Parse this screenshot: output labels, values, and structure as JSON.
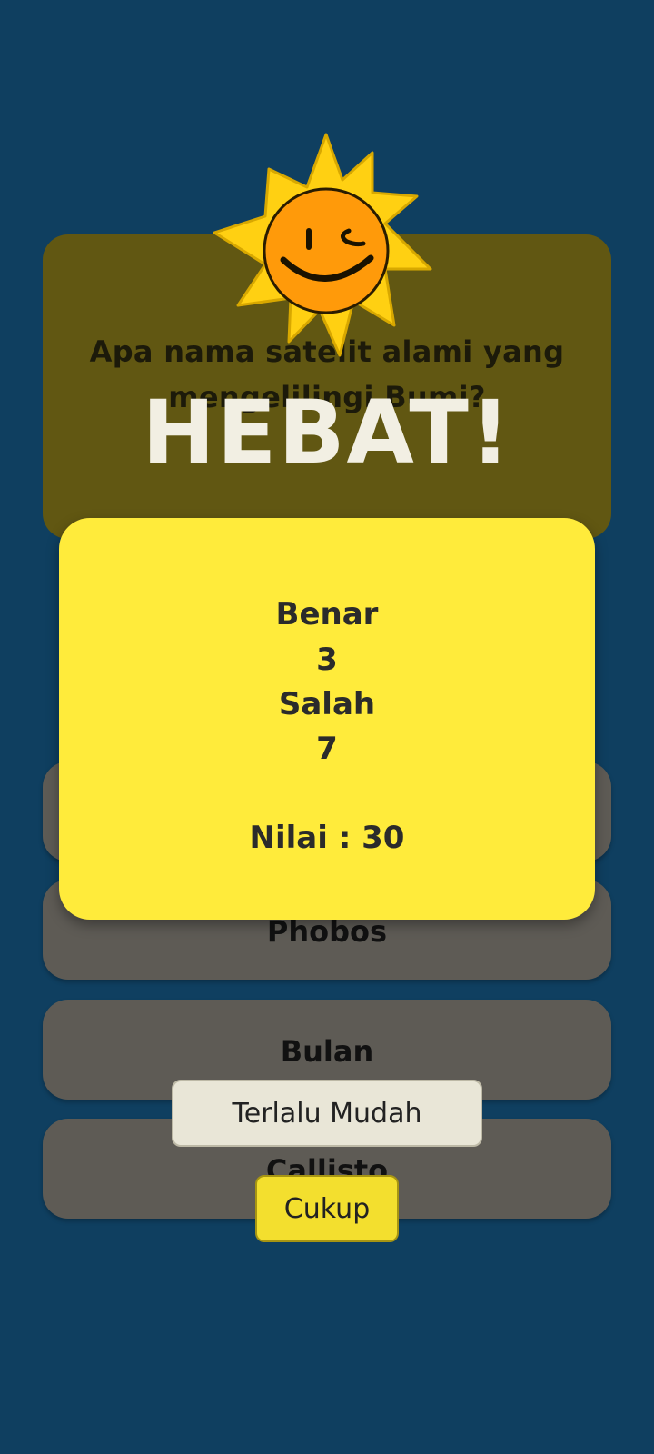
{
  "quiz": {
    "question": "Apa nama satelit alami yang mengelilingi Bumi?",
    "answers": [
      "Phobos",
      "Bulan",
      "Callisto"
    ]
  },
  "result": {
    "title": "HEBAT!",
    "correct_label": "Benar",
    "correct_value": "3",
    "wrong_label": "Salah",
    "wrong_value": "7",
    "score_text": "Nilai : 30"
  },
  "buttons": {
    "too_easy": "Terlalu Mudah",
    "enough": "Cukup"
  },
  "icons": {
    "mascot": "winking-sun-icon"
  },
  "colors": {
    "background": "#0f3f60",
    "result_card": "#ffeb3b",
    "question_card": "#615712",
    "answer_card": "#5e5b55",
    "cukup_button": "#f3df2e",
    "mudah_button": "#e9e6d7"
  }
}
